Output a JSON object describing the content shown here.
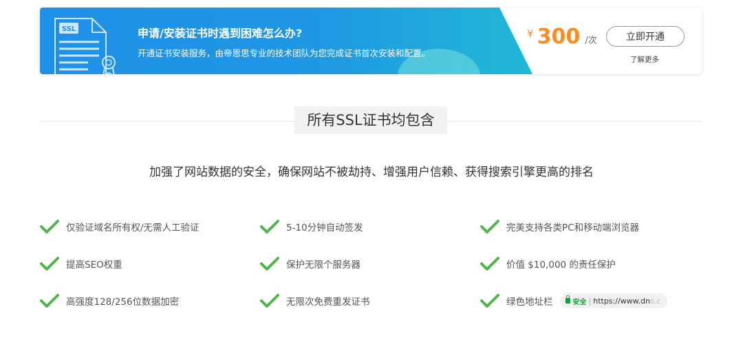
{
  "banner": {
    "title": "申请/安装证书时遇到困难怎么办?",
    "description": "开通证书安装服务，由帝恩思专业的技术团队为您完成证书首次安装和配置。",
    "doc_label": "SSL",
    "price_currency": "¥",
    "price_value": "300",
    "price_unit": "/次",
    "open_button": "立即开通",
    "learn_more": "了解更多",
    "colors": {
      "blue": "#1f90e8",
      "price": "#ff8a1e"
    }
  },
  "section": {
    "title": "所有SSL证书均包含",
    "subtitle": "加强了网站数据的安全，确保网站不被劫持、增强用户信赖、获得搜索引擎更高的排名"
  },
  "features": [
    "仅验证域名所有权/无需人工验证",
    "5-10分钟自动签发",
    "完美支持各类PC和移动端浏览器",
    "提高SEO权重",
    "保护无限个服务器",
    "价值 $10,000 的责任保护",
    "高强度128/256位数据加密",
    "无限次免费重发证书",
    "绿色地址栏"
  ],
  "address_bar": {
    "safe_label": "安全",
    "url": "https://www.dn",
    "url_fade": "s.c"
  },
  "check_color": "#4cb648"
}
